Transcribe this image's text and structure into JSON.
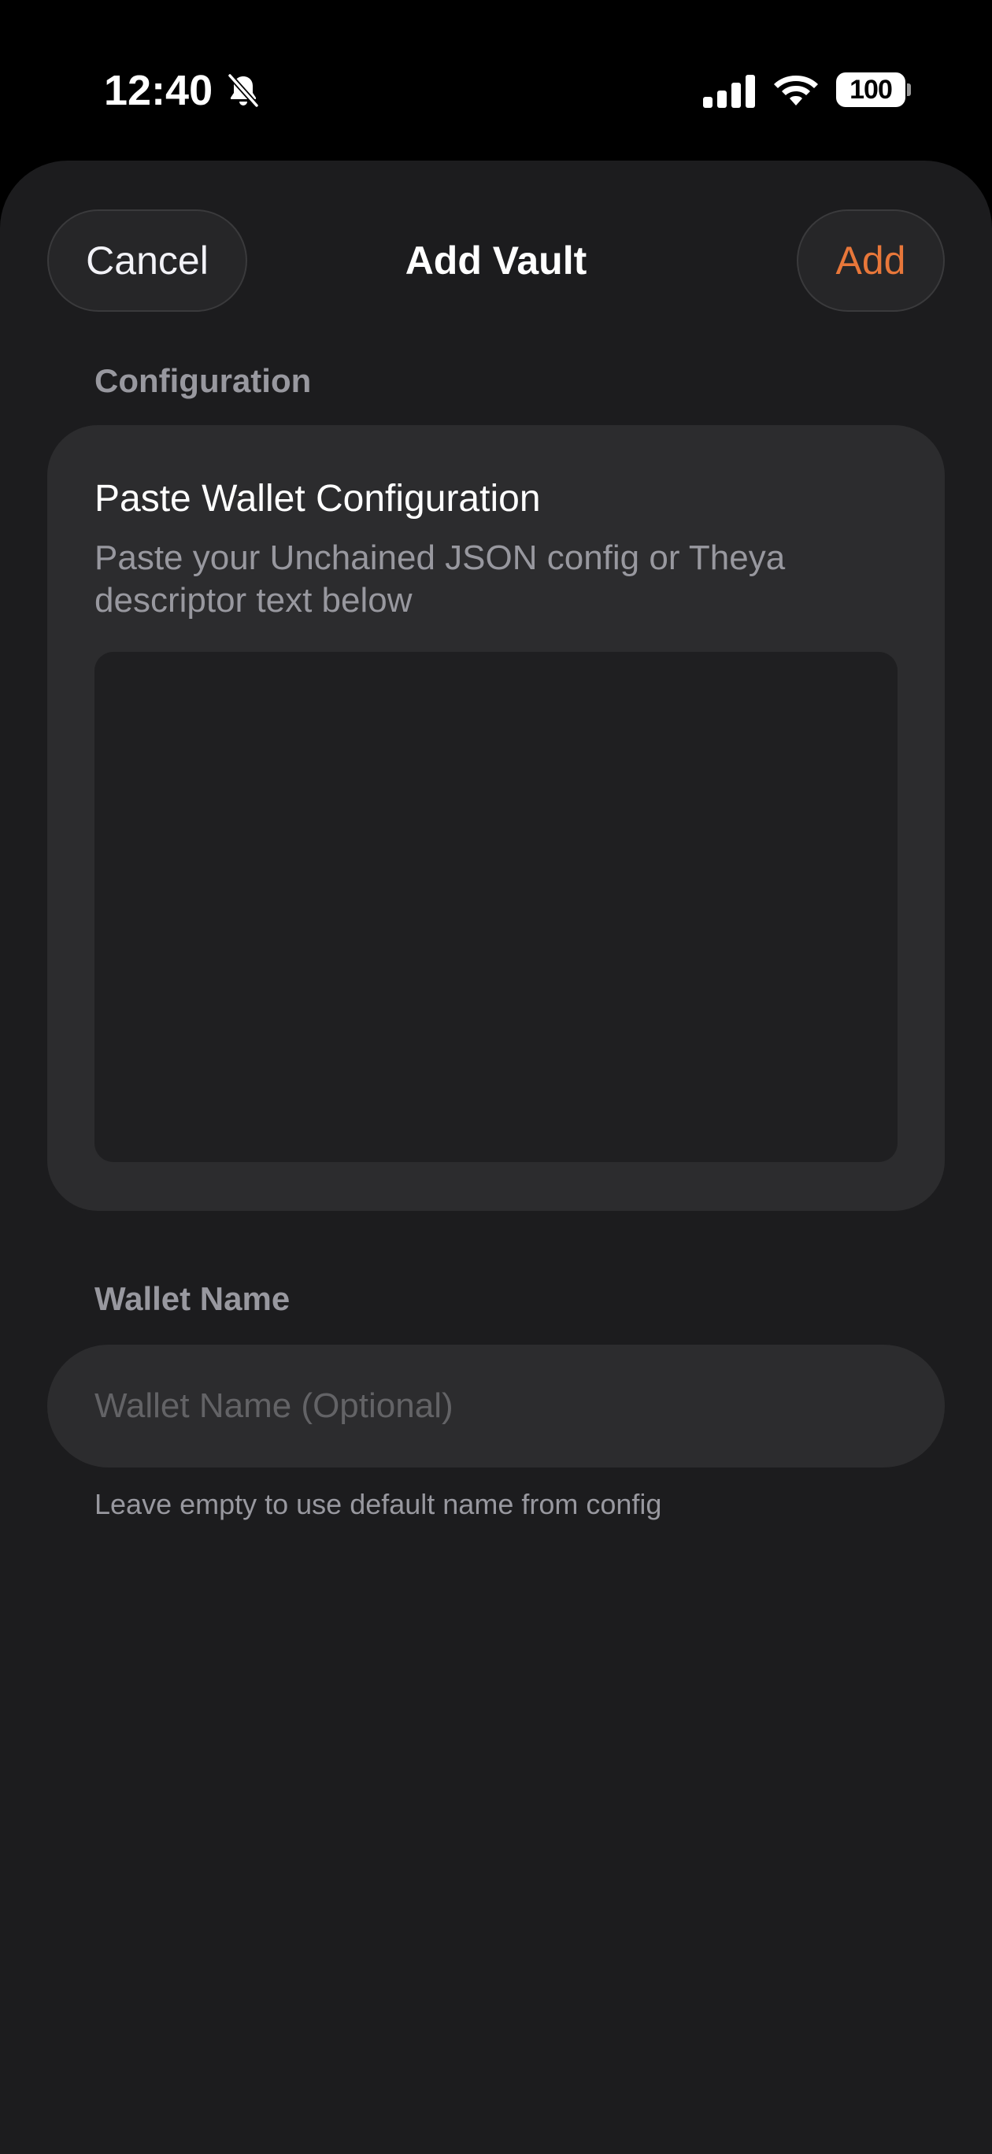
{
  "status_bar": {
    "time": "12:40",
    "battery": "100",
    "icons": [
      "bell-slash-icon",
      "cellular-signal-icon",
      "wifi-icon",
      "battery-icon"
    ]
  },
  "header": {
    "cancel_label": "Cancel",
    "title": "Add Vault",
    "add_label": "Add"
  },
  "configuration": {
    "section_label": "Configuration",
    "card_title": "Paste Wallet Configuration",
    "card_subtitle": "Paste your Unchained JSON config or Theya descriptor text below",
    "text_value": ""
  },
  "wallet_name": {
    "section_label": "Wallet Name",
    "placeholder": "Wallet Name (Optional)",
    "value": "",
    "helper": "Leave empty to use default name from config"
  },
  "colors": {
    "background": "#000000",
    "sheet": "#1c1c1e",
    "card": "#2c2c2e",
    "accent": "#e8773a",
    "secondary_text": "#98989f"
  }
}
